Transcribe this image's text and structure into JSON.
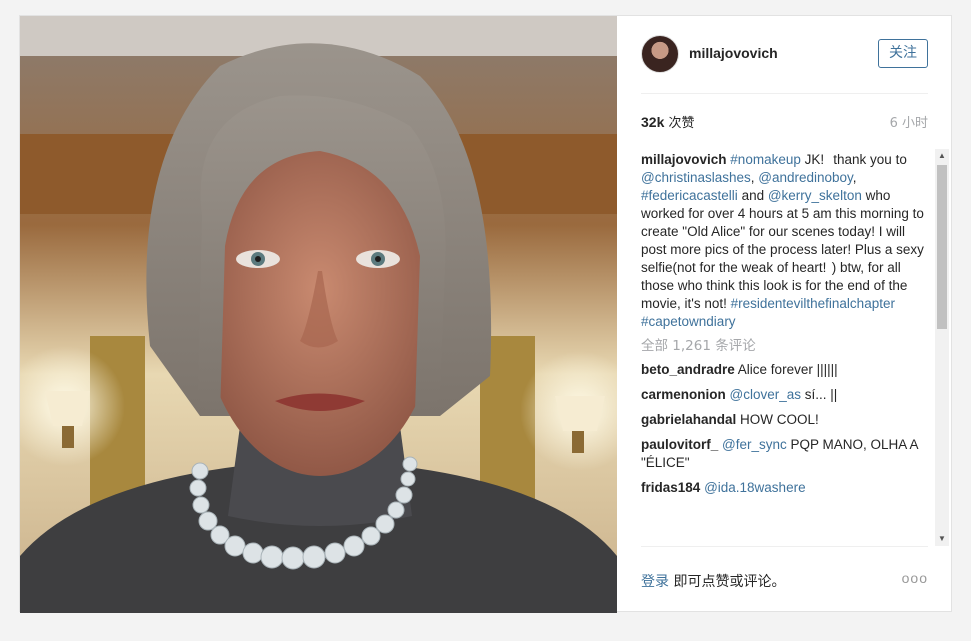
{
  "post": {
    "username": "millajovovich",
    "follow_label": "关注",
    "likes_count": "32k",
    "likes_suffix": " 次赞",
    "time_ago": "6 小时",
    "caption": {
      "username": "millajovovich",
      "tag1": "#nomakeup",
      "text1": " JK!   thank you to ",
      "mention1": "@christinaslashes",
      "text2": ", ",
      "mention2": "@andredinoboy",
      "text3": ", ",
      "tag2": "#federicacastelli",
      "text4": " and ",
      "mention3": "@kerry_skelton",
      "text5": "  who worked for over 4 hours at 5 am this morning to create \"Old Alice\" for our scenes today! I will post more pics of the process later! Plus a sexy selfie(not for the weak of heart!  ) btw, for all those who think this look is for the end of the movie, it's not! ",
      "tag3": "#residentevilthefinalchapter",
      "text6": " ",
      "tag4": "#capetowndiary"
    },
    "all_comments_label": "全部 1,261 条评论",
    "comments": [
      {
        "user": "beto_andradre",
        "mention": "",
        "text": "Alice forever ||||||"
      },
      {
        "user": "carmenonion",
        "mention": "@clover_as",
        "text": " sí... ||"
      },
      {
        "user": "gabrielahandal",
        "mention": "",
        "text": "HOW COOL!"
      },
      {
        "user": "paulovitorf_",
        "mention": "@fer_sync",
        "text": " PQP MANO, OLHA A \"ÉLICE\""
      },
      {
        "user": "fridas184",
        "mention": "@ida.18washere",
        "text": ""
      }
    ],
    "footer": {
      "login_link": "登录",
      "login_text": " 即可点赞或评论。",
      "more_label": "ooo"
    }
  },
  "icons": [
    "up-arrow-icon",
    "down-arrow-icon",
    "more-options-icon",
    "avatar"
  ],
  "colors": {
    "link": "#3f729b",
    "muted": "#a5a7aa",
    "text": "#262626"
  }
}
